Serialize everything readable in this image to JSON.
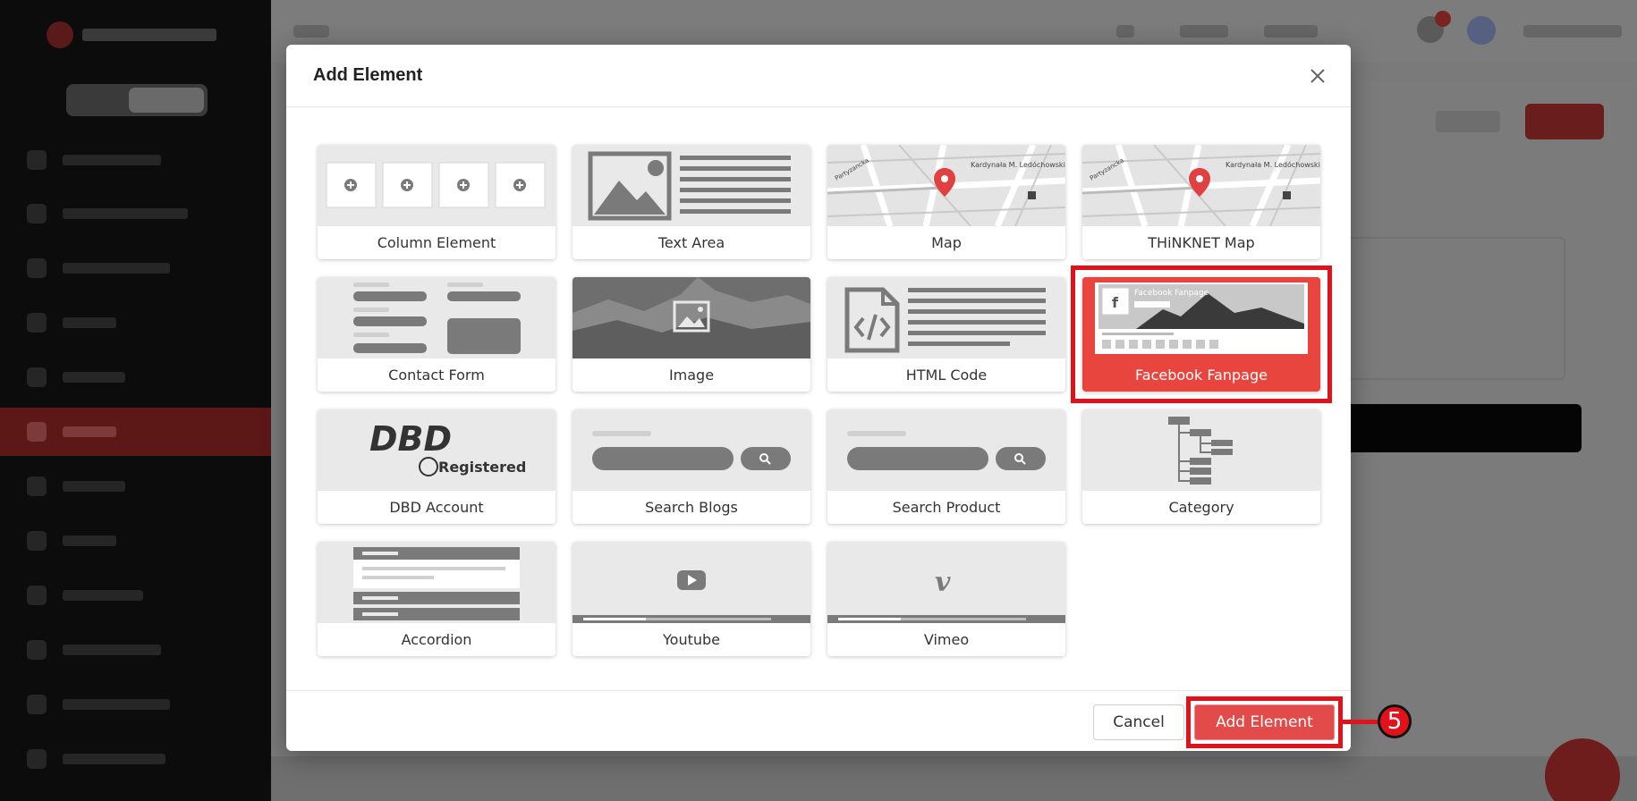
{
  "modal": {
    "title": "Add Element",
    "close_label": "×",
    "cancel_label": "Cancel",
    "add_label": "Add Element"
  },
  "callout": {
    "step": "5"
  },
  "elements": [
    {
      "label": "Column Element",
      "icon": "column-element-icon"
    },
    {
      "label": "Text Area",
      "icon": "text-area-icon"
    },
    {
      "label": "Map",
      "icon": "map-icon"
    },
    {
      "label": "THiNKNET Map",
      "icon": "thinknet-map-icon"
    },
    {
      "label": "Contact Form",
      "icon": "contact-form-icon"
    },
    {
      "label": "Image",
      "icon": "image-icon"
    },
    {
      "label": "HTML Code",
      "icon": "html-code-icon"
    },
    {
      "label": "Facebook Fanpage",
      "icon": "facebook-fanpage-icon",
      "selected": true,
      "thumb_text": "Facebook Fanpage"
    },
    {
      "label": "DBD Account",
      "icon": "dbd-account-icon",
      "thumb_text": "DBD",
      "thumb_sub": "Registered"
    },
    {
      "label": "Search Blogs",
      "icon": "search-blogs-icon"
    },
    {
      "label": "Search Product",
      "icon": "search-product-icon"
    },
    {
      "label": "Category",
      "icon": "category-icon"
    },
    {
      "label": "Accordion",
      "icon": "accordion-icon"
    },
    {
      "label": "Youtube",
      "icon": "youtube-icon"
    },
    {
      "label": "Vimeo",
      "icon": "vimeo-icon",
      "thumb_text": "v"
    }
  ],
  "map_text": {
    "street_a": "Kardynała M. Ledóchowskiego",
    "street_b": "Partyzancka"
  },
  "colors": {
    "accent": "#e34b4b",
    "highlight": "#e2121b",
    "selected_card": "#e8453f",
    "pin": "#e04040"
  }
}
